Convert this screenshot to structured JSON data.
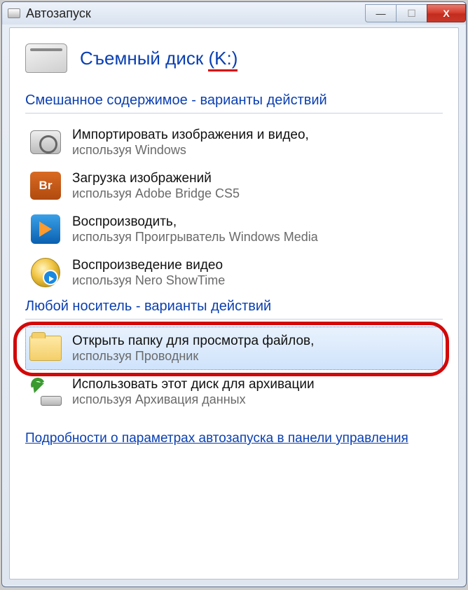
{
  "window": {
    "title": "Автозапуск"
  },
  "drive": {
    "label_main": "Съемный диск",
    "label_paren": "(K:)"
  },
  "sections": {
    "mixed": "Смешанное содержимое - варианты действий",
    "any": "Любой носитель - варианты действий"
  },
  "options": {
    "import": {
      "title": "Импортировать изображения и видео,",
      "sub": "используя Windows"
    },
    "bridge": {
      "title": "Загрузка изображений",
      "sub": "используя Adobe Bridge CS5",
      "icon_label": "Br"
    },
    "wmp": {
      "title": "Воспроизводить,",
      "sub": "используя Проигрыватель Windows Media"
    },
    "nero": {
      "title": "Воспроизведение видео",
      "sub": "используя Nero ShowTime"
    },
    "explorer": {
      "title": "Открыть папку для просмотра файлов,",
      "sub": "используя Проводник"
    },
    "backup": {
      "title": "Использовать этот диск для архивации",
      "sub": "используя Архивация данных"
    }
  },
  "footer": {
    "link": "Подробности о параметрах автозапуска в панели управления"
  }
}
